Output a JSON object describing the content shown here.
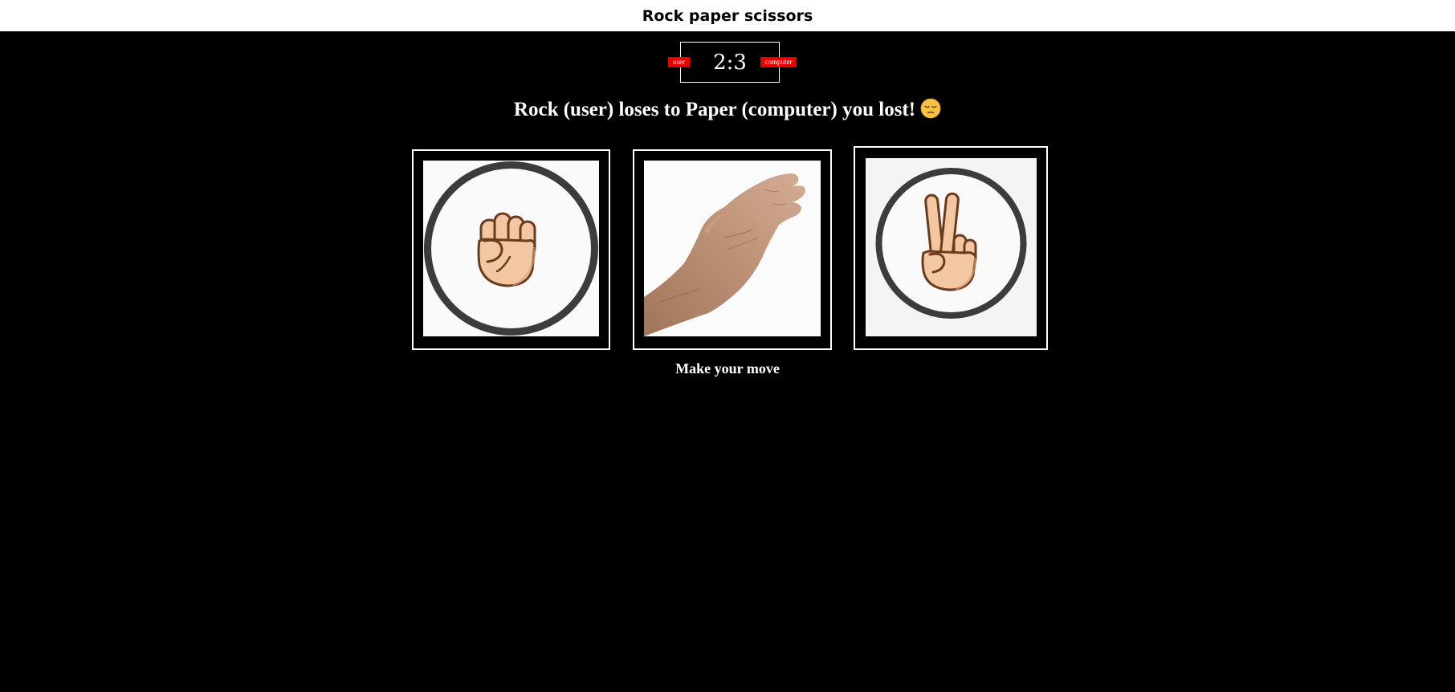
{
  "header": {
    "title": "Rock paper scissors"
  },
  "score": {
    "display": "2:3",
    "user_label": "user",
    "computer_label": "computer",
    "badge_color": "#e60000"
  },
  "result": {
    "message": "Rock (user) loses to Paper (computer) you lost!",
    "emoji": "pensive-face-icon"
  },
  "choices": [
    {
      "name": "rock",
      "icon": "fist-icon"
    },
    {
      "name": "paper",
      "icon": "open-hand-icon"
    },
    {
      "name": "scissors",
      "icon": "victory-hand-icon"
    }
  ],
  "prompt": "Make your move"
}
